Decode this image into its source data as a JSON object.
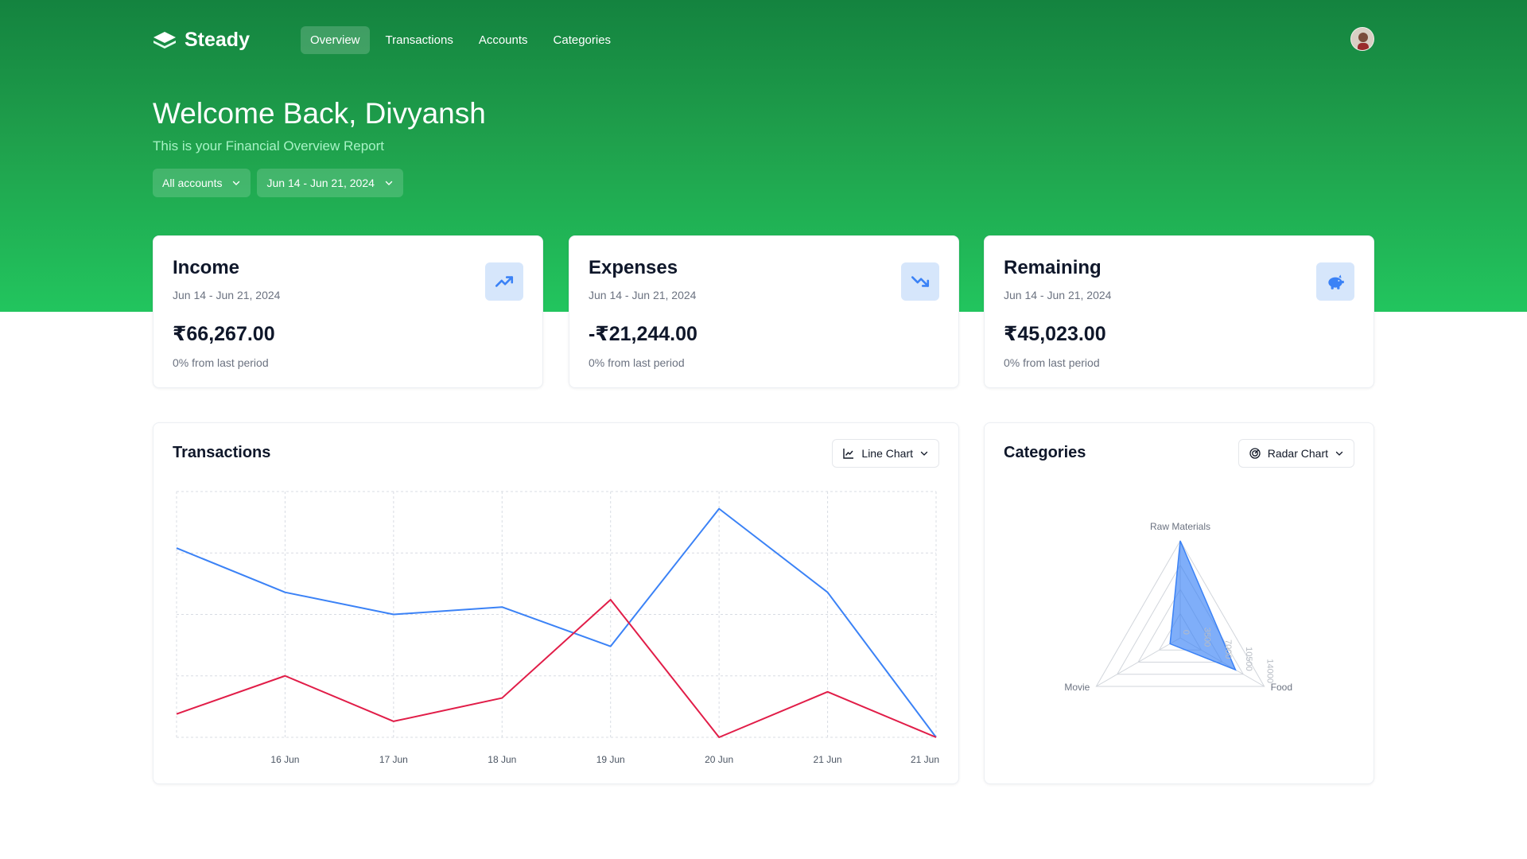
{
  "app": {
    "name": "Steady"
  },
  "nav": {
    "items": [
      {
        "label": "Overview",
        "active": true
      },
      {
        "label": "Transactions",
        "active": false
      },
      {
        "label": "Accounts",
        "active": false
      },
      {
        "label": "Categories",
        "active": false
      }
    ]
  },
  "header": {
    "welcome": "Welcome Back, Divyansh",
    "subtitle": "This is your Financial Overview Report",
    "account_filter": "All accounts",
    "date_filter": "Jun 14 - Jun 21, 2024"
  },
  "stats": [
    {
      "title": "Income",
      "range": "Jun 14 - Jun 21, 2024",
      "value": "₹66,267.00",
      "change": "0% from last period",
      "icon": "trending-up-icon"
    },
    {
      "title": "Expenses",
      "range": "Jun 14 - Jun 21, 2024",
      "value": "-₹21,244.00",
      "change": "0% from last period",
      "icon": "trending-down-icon"
    },
    {
      "title": "Remaining",
      "range": "Jun 14 - Jun 21, 2024",
      "value": "₹45,023.00",
      "change": "0% from last period",
      "icon": "piggy-bank-icon"
    }
  ],
  "transactions_panel": {
    "title": "Transactions",
    "chart_type_label": "Line Chart"
  },
  "categories_panel": {
    "title": "Categories",
    "chart_type_label": "Radar Chart"
  },
  "colors": {
    "brand": "#22c55e",
    "income": "#3b82f6",
    "expense": "#e11d48",
    "radar": "#3b82f6"
  },
  "chart_data": [
    {
      "type": "line",
      "categories": [
        "",
        "16 Jun",
        "17 Jun",
        "18 Jun",
        "19 Jun",
        "20 Jun",
        "21 Jun",
        "21 Jun"
      ],
      "series": [
        {
          "color": "#3b82f6",
          "values": [
            15400,
            11800,
            10000,
            10600,
            7400,
            18600,
            11800,
            0
          ]
        },
        {
          "color": "#e11d48",
          "values": [
            1900,
            5000,
            1300,
            3200,
            11200,
            0,
            3700,
            0
          ]
        }
      ],
      "ylim": [
        0,
        20000
      ],
      "grid": true,
      "legend": false
    },
    {
      "type": "radar",
      "axes": [
        "Raw Materials",
        "Food",
        "Movie"
      ],
      "values": [
        14000,
        9200,
        1700
      ],
      "radial_ticks": [
        "0",
        "3500",
        "7000",
        "10500",
        "14000"
      ],
      "rmax": 14000,
      "grid": true
    }
  ]
}
